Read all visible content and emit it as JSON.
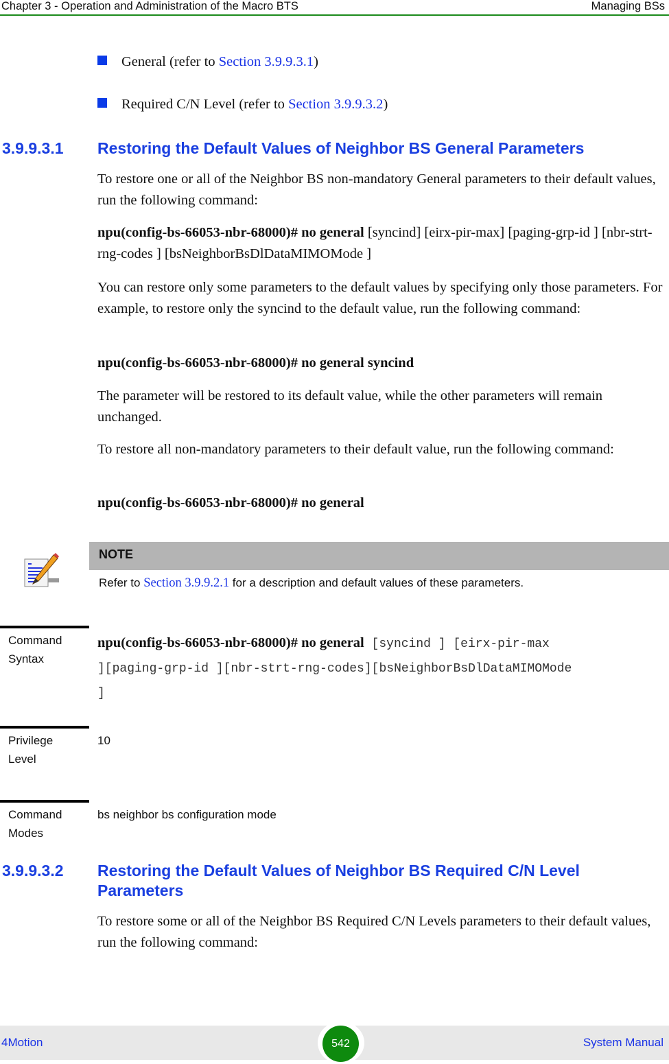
{
  "header": {
    "chapter": "Chapter 3 - Operation and Administration of the Macro BTS",
    "section": "Managing BSs"
  },
  "bullets": [
    {
      "text": "General (refer to ",
      "link": "Section 3.9.9.3.1",
      "tail": ")"
    },
    {
      "text": "Required C/N Level (refer to ",
      "link": "Section 3.9.9.3.2",
      "tail": ")"
    }
  ],
  "section1": {
    "number": "3.9.9.3.1",
    "title": "Restoring the Default Values of Neighbor BS General Parameters",
    "intro": "To restore one or all of the Neighbor BS non-mandatory General parameters to their default values, run the following command:",
    "command1_bold": "npu(config-bs-66053-nbr-68000)# no general",
    "command1_args": " [syncind] [eirx-pir-max] [paging-grp-id ] [nbr-strt-rng-codes ] [bsNeighborBsDlDataMIMOMode ]",
    "para2": "You can restore only some parameters to the default values by specifying only those parameters. For example, to restore only the syncind to the default value, run the following command:",
    "command2": "npu(config-bs-66053-nbr-68000)# no general syncind",
    "para3": "The parameter will be restored to its default value, while the other parameters will remain unchanged.",
    "para4": "To restore all non-mandatory parameters to their default value, run the following command:",
    "command3": "npu(config-bs-66053-nbr-68000)# no general"
  },
  "note": {
    "label": "NOTE",
    "text_prefix": "Refer to ",
    "link": "Section 3.9.9.2.1",
    "text_suffix": " for a description and default values of these parameters."
  },
  "definitions": {
    "syntax_label_1": "Command",
    "syntax_label_2": "Syntax",
    "syntax_cmd": "npu(config-bs-66053-nbr-68000)# no general",
    "syntax_args_1": " [syncind ] [eirx-pir-max",
    "syntax_args_2": "][paging-grp-id ][nbr-strt-rng-codes][bsNeighborBsDlDataMIMOMode",
    "syntax_args_3": "]",
    "privilege_label_1": "Privilege",
    "privilege_label_2": "Level",
    "privilege_value": "10",
    "modes_label_1": "Command",
    "modes_label_2": "Modes",
    "modes_value": "bs neighbor bs configuration mode"
  },
  "section2": {
    "number": "3.9.9.3.2",
    "title_line1": "Restoring the Default Values of Neighbor BS Required C/N Level",
    "title_line2": "Parameters",
    "intro": "To restore some or all of the Neighbor BS Required C/N Levels parameters to their default values, run the following command:"
  },
  "footer": {
    "product": "4Motion",
    "page": "542",
    "doc": "System Manual"
  },
  "colors": {
    "heading": "#1a3fe0",
    "link": "#1a33e6",
    "header_rule": "#1a8a1a",
    "page_badge": "#0e8a0e",
    "note_bar": "#b4b4b4",
    "footer_bg": "#e8e8e8"
  }
}
